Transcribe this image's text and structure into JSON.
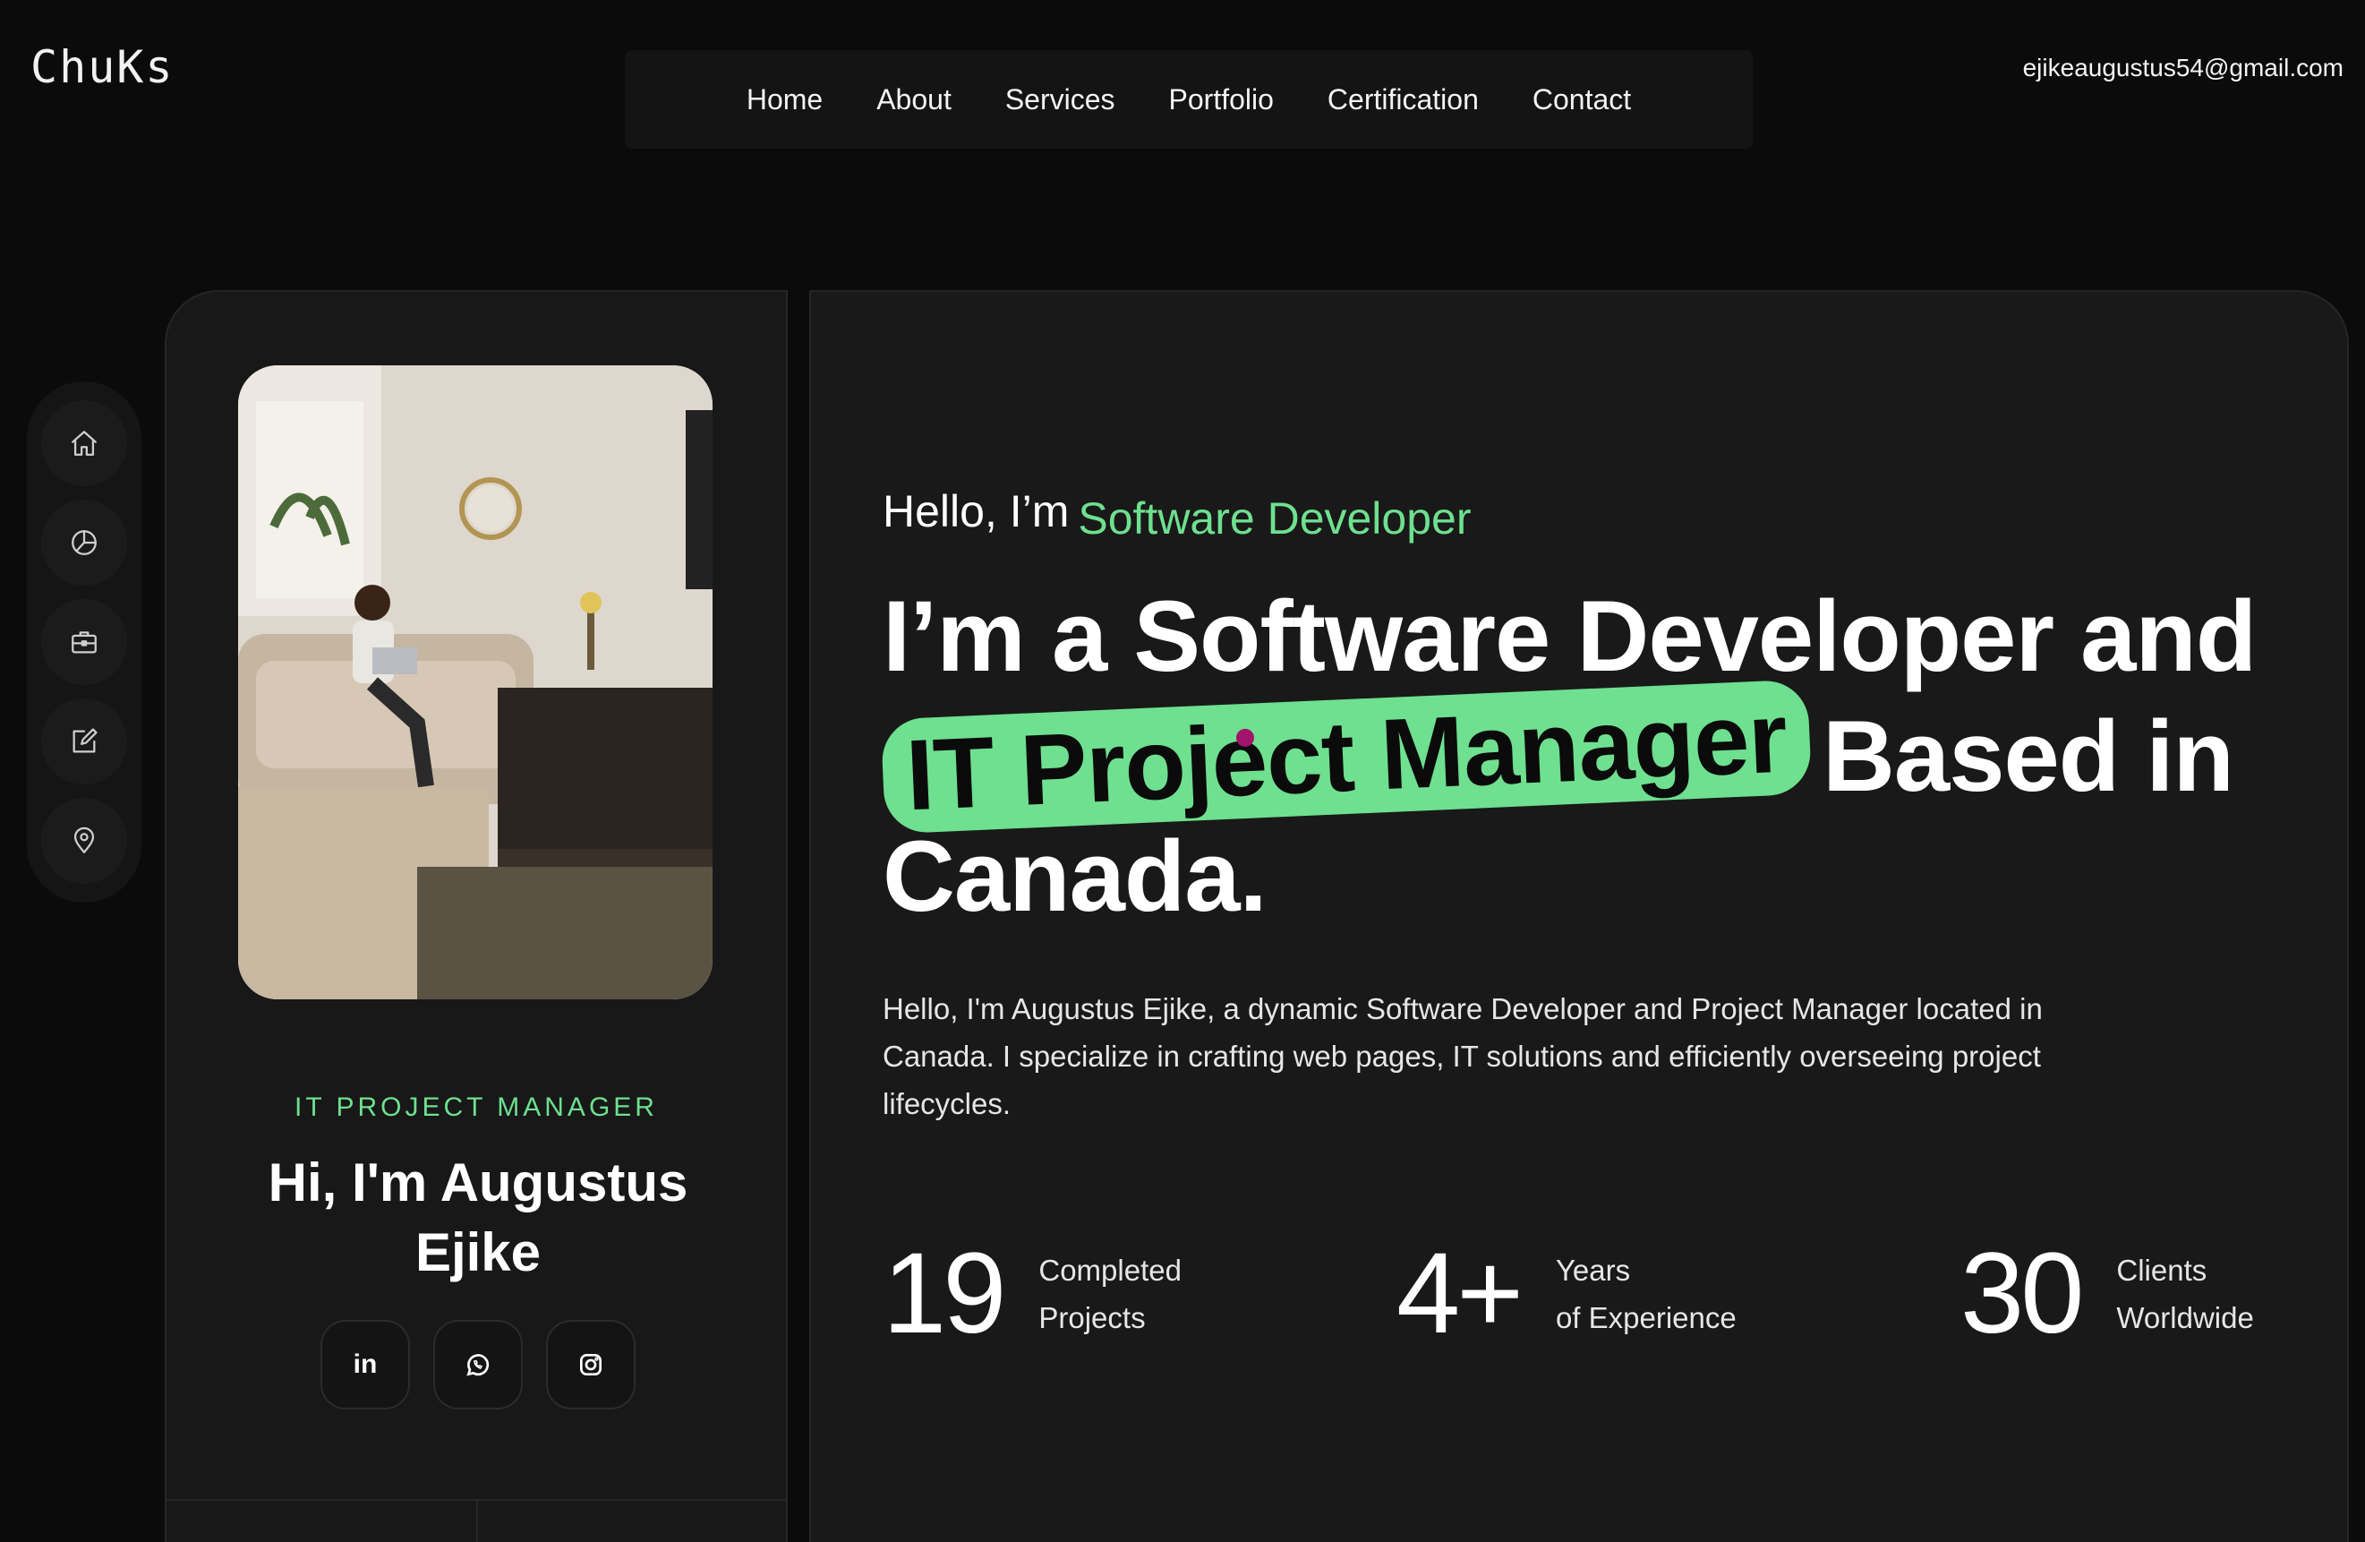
{
  "brand": {
    "logo": "ChuKs",
    "email": "ejikeaugustus54@gmail.com"
  },
  "nav": [
    {
      "label": "Home"
    },
    {
      "label": "About"
    },
    {
      "label": "Services"
    },
    {
      "label": "Portfolio"
    },
    {
      "label": "Certification"
    },
    {
      "label": "Contact"
    }
  ],
  "rail": {
    "icons": [
      "home-icon",
      "pie-chart-icon",
      "briefcase-icon",
      "edit-icon",
      "location-pin-icon"
    ]
  },
  "profile": {
    "role": "IT PROJECT MANAGER",
    "name": "Hi, I'm Augustus Ejike",
    "socials": [
      "linkedin-icon",
      "whatsapp-icon",
      "instagram-icon"
    ],
    "social_text": {
      "linkedin": "in"
    }
  },
  "hero": {
    "greeting": "Hello, I’m",
    "greeting_role": "Software Developer",
    "headline_part1": "I’m a Software Developer and",
    "headline_highlight": "IT Project Manager",
    "headline_part2": "Based in Canada.",
    "description": "Hello, I'm Augustus Ejike, a dynamic Software Developer and Project Manager located in Canada. I specialize in crafting web pages, IT solutions and efficiently overseeing project lifecycles.",
    "stats": [
      {
        "value": "19",
        "line1": "Completed",
        "line2": "Projects"
      },
      {
        "value": "4+",
        "line1": "Years",
        "line2": "of Experience"
      },
      {
        "value": "30",
        "line1": "Clients",
        "line2": "Worldwide"
      }
    ]
  },
  "colors": {
    "accent": "#6ee08f",
    "background": "#0b0b0b",
    "card": "#191919"
  }
}
